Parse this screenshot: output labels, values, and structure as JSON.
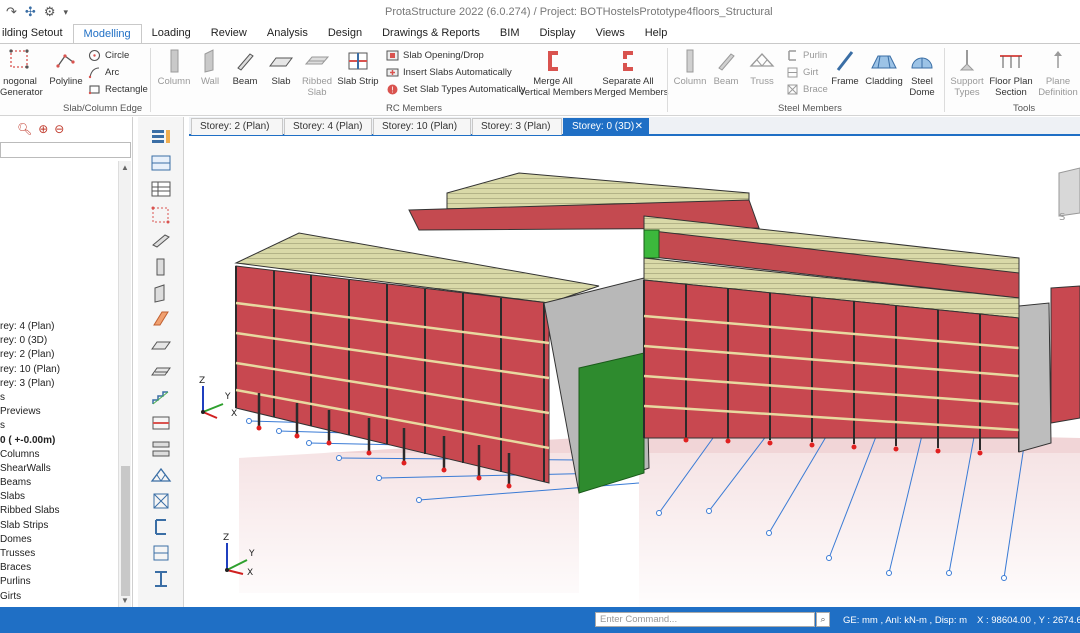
{
  "app": {
    "title": "ProtaStructure 2022 (6.0.274) / Project: BOTHostelsPrototype4floors_Structural"
  },
  "ribbon_tabs": [
    "ilding Setout",
    "Modelling",
    "Loading",
    "Review",
    "Analysis",
    "Design",
    "Drawings & Reports",
    "BIM",
    "Display",
    "Views",
    "Help"
  ],
  "ribbon": {
    "slab_column_edge": {
      "label": "Slab/Column Edge",
      "polygonal_generator": "nogonal\nGenerator",
      "polyline": "Polyline",
      "circle": "Circle",
      "arc": "Arc",
      "rectangle": "Rectangle"
    },
    "rc_members": {
      "label": "RC Members",
      "column": "Column",
      "wall": "Wall",
      "beam": "Beam",
      "slab": "Slab",
      "ribbed_slab": "Ribbed\nSlab",
      "slab_strip": "Slab Strip",
      "slab_opening": "Slab Opening/Drop",
      "insert_slabs": "Insert Slabs Automatically",
      "set_slab_types": "Set Slab Types Automatically",
      "merge_all": "Merge All\nVertical Members",
      "separate_all": "Separate All\nMerged Members"
    },
    "steel_members": {
      "label": "Steel Members",
      "column": "Column",
      "beam": "Beam",
      "truss": "Truss",
      "purlin": "Purlin",
      "girt": "Girt",
      "brace": "Brace",
      "frame": "Frame",
      "cladding": "Cladding",
      "steel_dome": "Steel\nDome"
    },
    "tools": {
      "label": "Tools",
      "support_types": "Support\nTypes",
      "floor_plan_section": "Floor Plan\nSection",
      "plane_definition": "Plane\nDefinition"
    }
  },
  "tree": [
    {
      "label": "rey: 4 (Plan)",
      "bold": false
    },
    {
      "label": "rey: 0 (3D)",
      "bold": false
    },
    {
      "label": "rey: 2 (Plan)",
      "bold": false
    },
    {
      "label": "rey: 10 (Plan)",
      "bold": false
    },
    {
      "label": "rey: 3 (Plan)",
      "bold": false
    },
    {
      "label": "s",
      "bold": false
    },
    {
      "label": "Previews",
      "bold": false
    },
    {
      "label": "s",
      "bold": false
    },
    {
      "label": "0 ( +-0.00m)",
      "bold": true
    },
    {
      "label": "Columns",
      "bold": false
    },
    {
      "label": "ShearWalls",
      "bold": false
    },
    {
      "label": "Beams",
      "bold": false
    },
    {
      "label": "Slabs",
      "bold": false
    },
    {
      "label": "Ribbed Slabs",
      "bold": false
    },
    {
      "label": "Slab Strips",
      "bold": false
    },
    {
      "label": "Domes",
      "bold": false
    },
    {
      "label": "Trusses",
      "bold": false
    },
    {
      "label": "Braces",
      "bold": false
    },
    {
      "label": "Purlins",
      "bold": false
    },
    {
      "label": "Girts",
      "bold": false
    }
  ],
  "view_tabs": [
    {
      "label": "Storey: 2 (Plan)",
      "active": false
    },
    {
      "label": "Storey: 4 (Plan)",
      "active": false
    },
    {
      "label": "Storey: 10 (Plan)",
      "active": false
    },
    {
      "label": "Storey: 3 (Plan)",
      "active": false
    },
    {
      "label": "Storey: 0 (3D)",
      "active": true
    }
  ],
  "view_tab_close": "✕",
  "axes": {
    "z": "Z",
    "y": "Y",
    "x": "X"
  },
  "status": {
    "command_placeholder": "Enter Command...",
    "units": "GE: mm , Anl: kN-m , Disp: m",
    "coords": "X : 98604.00 , Y : 2674.61"
  }
}
